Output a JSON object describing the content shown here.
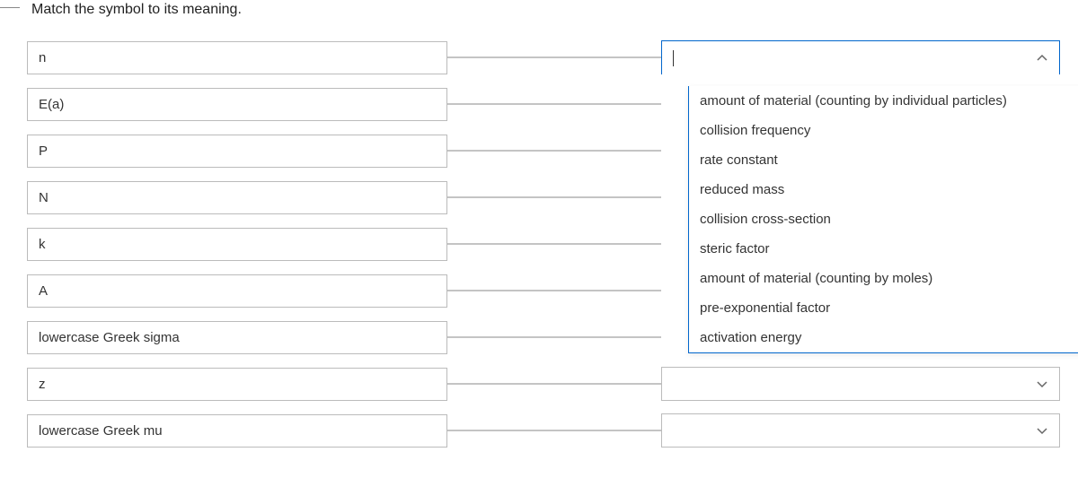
{
  "question": "Match the symbol to its meaning.",
  "symbols": [
    {
      "label": "n"
    },
    {
      "label": "E(a)"
    },
    {
      "label": "P"
    },
    {
      "label": "N"
    },
    {
      "label": "k"
    },
    {
      "label": "A"
    },
    {
      "label": "lowercase Greek sigma"
    },
    {
      "label": "z"
    },
    {
      "label": "lowercase Greek mu"
    }
  ],
  "options": [
    "amount of material (counting by individual particles)",
    "collision frequency",
    "rate constant",
    "reduced mass",
    "collision cross-section",
    "steric factor",
    "amount of material (counting by moles)",
    "pre-exponential factor",
    "activation energy"
  ],
  "open_dropdown_index": 0
}
